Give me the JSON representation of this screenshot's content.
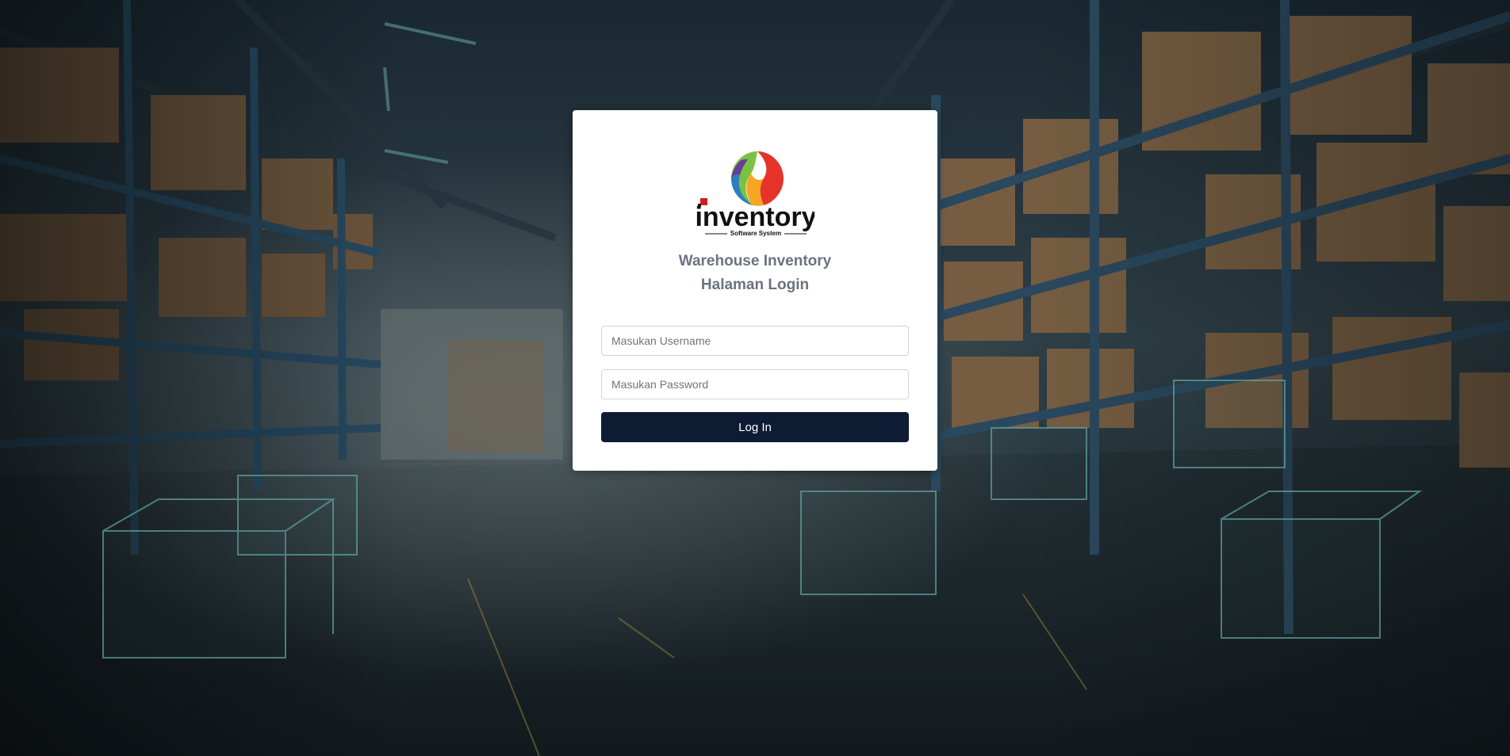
{
  "app": {
    "title_line1": "Warehouse Inventory",
    "title_line2": "Halaman Login"
  },
  "logo": {
    "wordmark": "inventory",
    "tagline": "Software System",
    "colors": [
      "#7cc242",
      "#e63329",
      "#f6a623",
      "#2e7fc1",
      "#6a3d9a"
    ]
  },
  "form": {
    "username_placeholder": "Masukan Username",
    "username_value": "",
    "password_placeholder": "Masukan Password",
    "password_value": "",
    "submit_label": "Log In"
  },
  "colors": {
    "button_bg": "#0d1b33",
    "card_bg": "#ffffff",
    "title_color": "#6b7280"
  },
  "icons": [
    "inventory-logo-icon",
    "warehouse-background-image"
  ]
}
